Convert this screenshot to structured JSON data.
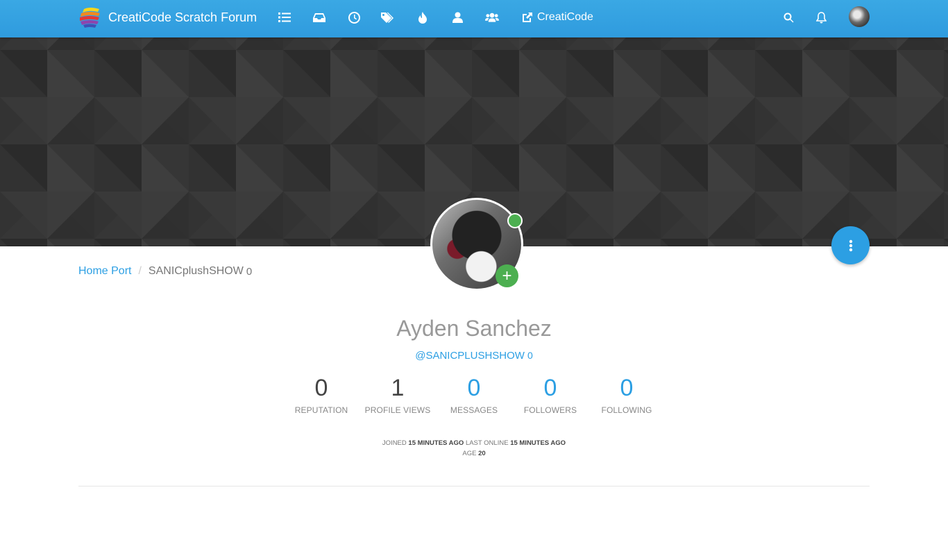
{
  "header": {
    "brand_title": "CreatiCode Scratch Forum",
    "nav_icons": [
      "categories-icon",
      "unread-icon",
      "recent-icon",
      "tags-icon",
      "popular-icon",
      "users-icon",
      "groups-icon"
    ],
    "external_link_label": "CreatiCode",
    "accent_color": "#2f9bde"
  },
  "breadcrumb": {
    "home": "Home Port",
    "separator": "/",
    "current": "SANICplushSHOW",
    "current_count": "0"
  },
  "profile": {
    "fullname": "Ayden Sanchez",
    "handle": "@SANICPLUSHSHOW",
    "handle_count": "0",
    "follow_symbol": "+",
    "online_status_color": "#4caf50"
  },
  "stats": [
    {
      "value": "0",
      "label": "REPUTATION"
    },
    {
      "value": "1",
      "label": "PROFILE VIEWS"
    },
    {
      "value": "0",
      "label": "MESSAGES"
    },
    {
      "value": "0",
      "label": "FOLLOWERS"
    },
    {
      "value": "0",
      "label": "FOLLOWING"
    }
  ],
  "meta": {
    "joined_label": "JOINED",
    "joined_value": "15 MINUTES AGO",
    "last_online_label": "LAST ONLINE",
    "last_online_value": "15 MINUTES AGO",
    "age_label": "AGE",
    "age_value": "20"
  }
}
